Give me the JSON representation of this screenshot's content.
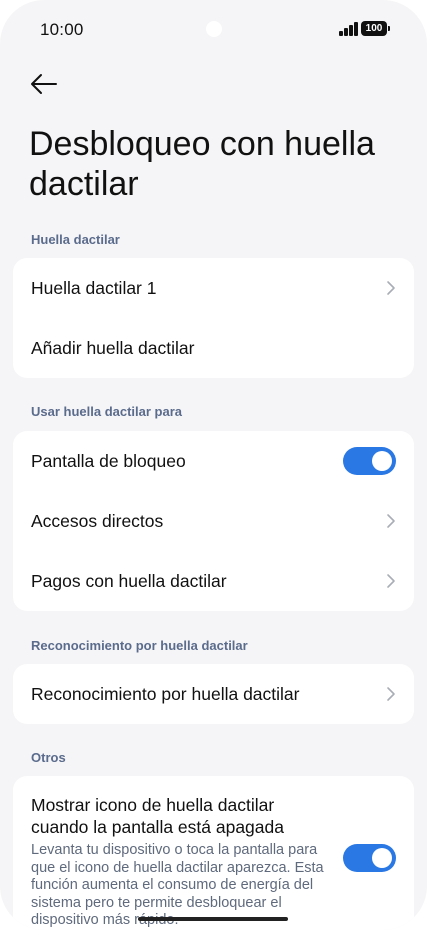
{
  "status_bar": {
    "time": "10:00",
    "battery": "100",
    "icons": [
      "signal-icon",
      "battery-icon"
    ]
  },
  "header": {
    "back_icon": "arrow-left-icon",
    "title": "Desbloqueo con huella dactilar"
  },
  "sections": {
    "fingerprints": {
      "header": "Huella dactilar",
      "items": [
        {
          "label": "Huella dactilar 1",
          "control": "chevron"
        },
        {
          "label": "Añadir huella dactilar",
          "control": "none"
        }
      ]
    },
    "use_for": {
      "header": "Usar huella dactilar para",
      "items": [
        {
          "label": "Pantalla de bloqueo",
          "control": "toggle",
          "on": true
        },
        {
          "label": "Accesos directos",
          "control": "chevron"
        },
        {
          "label": "Pagos con huella dactilar",
          "control": "chevron"
        }
      ]
    },
    "recognition": {
      "header": "Reconocimiento por huella dactilar",
      "items": [
        {
          "label": "Reconocimiento por huella dactilar",
          "control": "chevron"
        }
      ]
    },
    "others": {
      "header": "Otros",
      "items": [
        {
          "title": "Mostrar icono de huella dactilar cuando la pantalla está apagada",
          "description": "Levanta tu dispositivo o toca la pantalla para que el icono de huella dactilar aparezca. Esta función aumenta el consumo de energía del sistema pero te permite desbloquear el dispositivo más rápido.",
          "control": "toggle",
          "on": true
        }
      ]
    }
  },
  "colors": {
    "accent": "#2a78e4",
    "background": "#f5f5f7",
    "card": "#ffffff",
    "section_header": "#5a6b8c"
  }
}
